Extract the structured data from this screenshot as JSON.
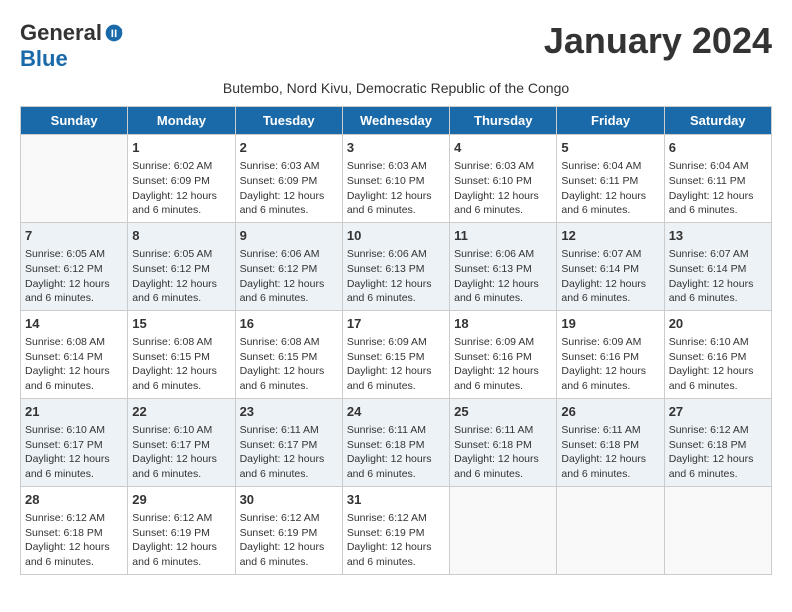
{
  "logo": {
    "general": "General",
    "blue": "Blue"
  },
  "title": "January 2024",
  "subtitle": "Butembo, Nord Kivu, Democratic Republic of the Congo",
  "days_of_week": [
    "Sunday",
    "Monday",
    "Tuesday",
    "Wednesday",
    "Thursday",
    "Friday",
    "Saturday"
  ],
  "weeks": [
    [
      {
        "num": "",
        "info": ""
      },
      {
        "num": "1",
        "info": "Sunrise: 6:02 AM\nSunset: 6:09 PM\nDaylight: 12 hours and 6 minutes."
      },
      {
        "num": "2",
        "info": "Sunrise: 6:03 AM\nSunset: 6:09 PM\nDaylight: 12 hours and 6 minutes."
      },
      {
        "num": "3",
        "info": "Sunrise: 6:03 AM\nSunset: 6:10 PM\nDaylight: 12 hours and 6 minutes."
      },
      {
        "num": "4",
        "info": "Sunrise: 6:03 AM\nSunset: 6:10 PM\nDaylight: 12 hours and 6 minutes."
      },
      {
        "num": "5",
        "info": "Sunrise: 6:04 AM\nSunset: 6:11 PM\nDaylight: 12 hours and 6 minutes."
      },
      {
        "num": "6",
        "info": "Sunrise: 6:04 AM\nSunset: 6:11 PM\nDaylight: 12 hours and 6 minutes."
      }
    ],
    [
      {
        "num": "7",
        "info": "Sunrise: 6:05 AM\nSunset: 6:12 PM\nDaylight: 12 hours and 6 minutes."
      },
      {
        "num": "8",
        "info": "Sunrise: 6:05 AM\nSunset: 6:12 PM\nDaylight: 12 hours and 6 minutes."
      },
      {
        "num": "9",
        "info": "Sunrise: 6:06 AM\nSunset: 6:12 PM\nDaylight: 12 hours and 6 minutes."
      },
      {
        "num": "10",
        "info": "Sunrise: 6:06 AM\nSunset: 6:13 PM\nDaylight: 12 hours and 6 minutes."
      },
      {
        "num": "11",
        "info": "Sunrise: 6:06 AM\nSunset: 6:13 PM\nDaylight: 12 hours and 6 minutes."
      },
      {
        "num": "12",
        "info": "Sunrise: 6:07 AM\nSunset: 6:14 PM\nDaylight: 12 hours and 6 minutes."
      },
      {
        "num": "13",
        "info": "Sunrise: 6:07 AM\nSunset: 6:14 PM\nDaylight: 12 hours and 6 minutes."
      }
    ],
    [
      {
        "num": "14",
        "info": "Sunrise: 6:08 AM\nSunset: 6:14 PM\nDaylight: 12 hours and 6 minutes."
      },
      {
        "num": "15",
        "info": "Sunrise: 6:08 AM\nSunset: 6:15 PM\nDaylight: 12 hours and 6 minutes."
      },
      {
        "num": "16",
        "info": "Sunrise: 6:08 AM\nSunset: 6:15 PM\nDaylight: 12 hours and 6 minutes."
      },
      {
        "num": "17",
        "info": "Sunrise: 6:09 AM\nSunset: 6:15 PM\nDaylight: 12 hours and 6 minutes."
      },
      {
        "num": "18",
        "info": "Sunrise: 6:09 AM\nSunset: 6:16 PM\nDaylight: 12 hours and 6 minutes."
      },
      {
        "num": "19",
        "info": "Sunrise: 6:09 AM\nSunset: 6:16 PM\nDaylight: 12 hours and 6 minutes."
      },
      {
        "num": "20",
        "info": "Sunrise: 6:10 AM\nSunset: 6:16 PM\nDaylight: 12 hours and 6 minutes."
      }
    ],
    [
      {
        "num": "21",
        "info": "Sunrise: 6:10 AM\nSunset: 6:17 PM\nDaylight: 12 hours and 6 minutes."
      },
      {
        "num": "22",
        "info": "Sunrise: 6:10 AM\nSunset: 6:17 PM\nDaylight: 12 hours and 6 minutes."
      },
      {
        "num": "23",
        "info": "Sunrise: 6:11 AM\nSunset: 6:17 PM\nDaylight: 12 hours and 6 minutes."
      },
      {
        "num": "24",
        "info": "Sunrise: 6:11 AM\nSunset: 6:18 PM\nDaylight: 12 hours and 6 minutes."
      },
      {
        "num": "25",
        "info": "Sunrise: 6:11 AM\nSunset: 6:18 PM\nDaylight: 12 hours and 6 minutes."
      },
      {
        "num": "26",
        "info": "Sunrise: 6:11 AM\nSunset: 6:18 PM\nDaylight: 12 hours and 6 minutes."
      },
      {
        "num": "27",
        "info": "Sunrise: 6:12 AM\nSunset: 6:18 PM\nDaylight: 12 hours and 6 minutes."
      }
    ],
    [
      {
        "num": "28",
        "info": "Sunrise: 6:12 AM\nSunset: 6:18 PM\nDaylight: 12 hours and 6 minutes."
      },
      {
        "num": "29",
        "info": "Sunrise: 6:12 AM\nSunset: 6:19 PM\nDaylight: 12 hours and 6 minutes."
      },
      {
        "num": "30",
        "info": "Sunrise: 6:12 AM\nSunset: 6:19 PM\nDaylight: 12 hours and 6 minutes."
      },
      {
        "num": "31",
        "info": "Sunrise: 6:12 AM\nSunset: 6:19 PM\nDaylight: 12 hours and 6 minutes."
      },
      {
        "num": "",
        "info": ""
      },
      {
        "num": "",
        "info": ""
      },
      {
        "num": "",
        "info": ""
      }
    ]
  ]
}
